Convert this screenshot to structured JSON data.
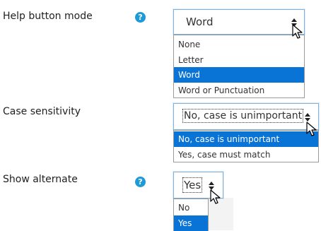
{
  "fields": [
    {
      "label": "Help button mode",
      "has_help": true,
      "selected_value": "Word",
      "options": [
        "None",
        "Letter",
        "Word",
        "Word or Punctuation"
      ],
      "selected_index": 2
    },
    {
      "label": "Case sensitivity",
      "has_help": false,
      "selected_value": "No, case is unimportant",
      "options": [
        "No, case is unimportant",
        "Yes, case must match"
      ],
      "selected_index": 0
    },
    {
      "label": "Show alternate",
      "has_help": true,
      "selected_value": "Yes",
      "options": [
        "No",
        "Yes"
      ],
      "selected_index": 1
    }
  ],
  "help_icon": "question-circle-icon",
  "colors": {
    "accent": "#0a74d6",
    "help": "#1e9bd7",
    "focus_border": "#7fb2dc"
  }
}
